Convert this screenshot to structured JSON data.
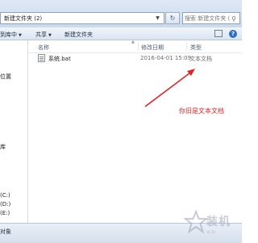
{
  "address_bar": {
    "path": "新建文件夹 (2)",
    "search_placeholder": "搜索 新建文件夹 (2)",
    "refresh_glyph": "↻"
  },
  "toolbar": {
    "include_in_library": "到库中",
    "share": "共享",
    "new_folder": "新建文件夹"
  },
  "nav_pane": {
    "items": [
      "位置",
      "库",
      "(C:)",
      "(D:)",
      "(E:)"
    ]
  },
  "columns": {
    "name": "名称",
    "date_modified": "修改日期",
    "type": "类型"
  },
  "files": [
    {
      "name": "系统.bat",
      "date_modified": "2016-04-01 15:09",
      "type": "文本文档",
      "icon": "text-file-icon"
    }
  ],
  "annotation": {
    "text": "你旧是文本文档",
    "color": "#e0242a"
  },
  "status_bar": {
    "text": "对象"
  },
  "watermark": {
    "text": "装机",
    "url": "w.lo"
  },
  "colors": {
    "accent": "#2f6fc0",
    "annotation": "#e0242a"
  }
}
